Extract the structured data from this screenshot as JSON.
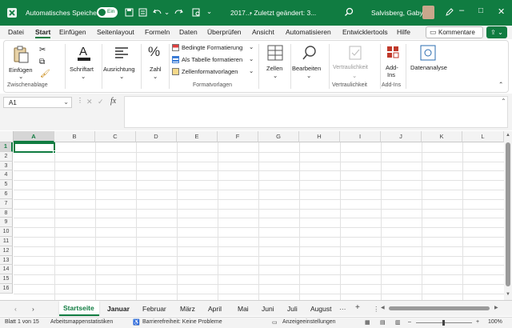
{
  "titlebar": {
    "autosave_label": "Automatisches Speichern",
    "toggle_label": "Ein",
    "file_name": "2017...",
    "modified": "• Zuletzt geändert: 3...",
    "user_name": "Salvisberg, Gaby",
    "icons": [
      "excel-logo-icon",
      "save-icon",
      "undo-icon",
      "redo-icon",
      "search-icon",
      "minimize-icon",
      "maximize-icon",
      "close-icon"
    ]
  },
  "tabs": [
    "Datei",
    "Start",
    "Einfügen",
    "Seitenlayout",
    "Formeln",
    "Daten",
    "Überprüfen",
    "Ansicht",
    "Automatisieren",
    "Entwicklertools",
    "Hilfe"
  ],
  "active_tab": "Start",
  "comments_button": "Kommentare",
  "ribbon": {
    "paste": "Einfügen",
    "clipboard_group": "Zwischenablage",
    "font": "Schriftart",
    "alignment": "Ausrichtung",
    "number": "Zahl",
    "cond_format": "Bedingte Formatierung",
    "as_table": "Als Tabelle formatieren",
    "cell_styles": "Zellenformatvorlagen",
    "styles_group": "Formatvorlagen",
    "cells": "Zellen",
    "edit": "Bearbeiten",
    "sensitivity": "Vertraulichkeit",
    "sensitivity_group": "Vertraulichkeit",
    "addins_l1": "Add-",
    "addins_l2": "Ins",
    "addins_group": "Add-Ins",
    "analyze": "Datenanalyse"
  },
  "formula_bar": {
    "name_box": "A1",
    "fx": "fx",
    "formula": ""
  },
  "grid": {
    "columns": [
      "A",
      "B",
      "C",
      "D",
      "E",
      "F",
      "G",
      "H",
      "I",
      "J",
      "K",
      "L"
    ],
    "rows": [
      "1",
      "2",
      "3",
      "4",
      "5",
      "6",
      "7",
      "8",
      "9",
      "10",
      "11",
      "12",
      "13",
      "14",
      "15",
      "16"
    ],
    "selected_cell": "A1"
  },
  "sheets": [
    "Startseite",
    "Januar",
    "Februar",
    "März",
    "April",
    "Mai",
    "Juni",
    "Juli",
    "August"
  ],
  "active_sheet": "Startseite",
  "status": {
    "sheet_info": "Blatt 1 von 15",
    "workbook_stats": "Arbeitsmappenstatistiken",
    "accessibility": "Barrierefreiheit: Keine Probleme",
    "display_settings": "Anzeigeeinstellungen",
    "zoom": "100%"
  }
}
